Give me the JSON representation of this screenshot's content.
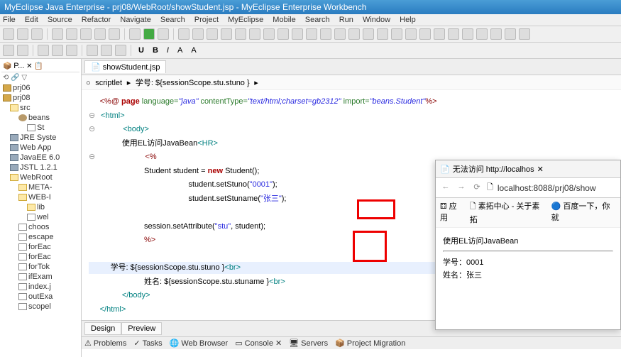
{
  "window_title": "MyEclipse Java Enterprise - prj08/WebRoot/showStudent.jsp - MyEclipse Enterprise Workbench",
  "menu": [
    "File",
    "Edit",
    "Source",
    "Refactor",
    "Navigate",
    "Search",
    "Project",
    "MyEclipse",
    "Mobile",
    "Search",
    "Run",
    "Window",
    "Help"
  ],
  "sidebar_title": "P...",
  "tree": [
    {
      "label": "prj06",
      "ic": "ic-proj",
      "ind": ""
    },
    {
      "label": "prj08",
      "ic": "ic-proj",
      "ind": ""
    },
    {
      "label": "src",
      "ic": "ic-fold",
      "ind": "ind1"
    },
    {
      "label": "beans",
      "ic": "ic-pkg",
      "ind": "ind2"
    },
    {
      "label": "St",
      "ic": "ic-file",
      "ind": "ind3"
    },
    {
      "label": "JRE Syste",
      "ic": "ic-lib",
      "ind": "ind1"
    },
    {
      "label": "Web App",
      "ic": "ic-lib",
      "ind": "ind1"
    },
    {
      "label": "JavaEE 6.0",
      "ic": "ic-lib",
      "ind": "ind1"
    },
    {
      "label": "JSTL 1.2.1",
      "ic": "ic-lib",
      "ind": "ind1"
    },
    {
      "label": "WebRoot",
      "ic": "ic-fold",
      "ind": "ind1"
    },
    {
      "label": "META-",
      "ic": "ic-fold",
      "ind": "ind2"
    },
    {
      "label": "WEB-I",
      "ic": "ic-fold",
      "ind": "ind2"
    },
    {
      "label": "lib",
      "ic": "ic-fold",
      "ind": "ind3"
    },
    {
      "label": "wel",
      "ic": "ic-file",
      "ind": "ind3"
    },
    {
      "label": "choos",
      "ic": "ic-file",
      "ind": "ind2"
    },
    {
      "label": "escape",
      "ic": "ic-file",
      "ind": "ind2"
    },
    {
      "label": "forEac",
      "ic": "ic-file",
      "ind": "ind2"
    },
    {
      "label": "forEac",
      "ic": "ic-file",
      "ind": "ind2"
    },
    {
      "label": "forTok",
      "ic": "ic-file",
      "ind": "ind2"
    },
    {
      "label": "ifExam",
      "ic": "ic-file",
      "ind": "ind2"
    },
    {
      "label": "index.j",
      "ic": "ic-file",
      "ind": "ind2"
    },
    {
      "label": "outExa",
      "ic": "ic-file",
      "ind": "ind2"
    },
    {
      "label": "scopel",
      "ic": "ic-file",
      "ind": "ind2"
    }
  ],
  "editor_tab": "showStudent.jsp",
  "breadcrumb_prefix": "scriptlet",
  "breadcrumb_text": "学号: ${sessionScope.stu.stuno }",
  "code": {
    "l1_pre": "<%@ ",
    "l1_page": "page",
    "l1_lang": " language=",
    "l1_langv": "\"java\"",
    "l1_ct": " contentType=",
    "l1_ctv": "\"text/html;charset=gb2312\"",
    "l1_imp": " import=",
    "l1_impv": "\"beans.Student\"",
    "l1_end": "%>",
    "l2": "<html>",
    "l3": "<body>",
    "l4_txt": "使用EL访问JavaBean",
    "l4_hr": "<HR>",
    "l5": "<%",
    "l6a": "Student student = ",
    "l6b": "new",
    "l6c": " Student();",
    "l7": "student.setStuno(",
    "l7v": "\"0001\"",
    "l7e": ");",
    "l8": "student.setStuname(",
    "l8v": "\"张三\"",
    "l8e": ");",
    "l10a": "session.setAttribute(",
    "l10v": "\"stu\"",
    "l10b": ", student);",
    "l11": "%>",
    "l13a": "学号: ${sessionScope",
    "l13b": ".stu.",
    "l13c": "stuno }",
    "l13br": "<br>",
    "l14a": "姓名: ${sessionScope",
    "l14b": ".stu.",
    "l14c": "stuname }",
    "l14br": "<br>",
    "l15": "</body>",
    "l16": "</html>"
  },
  "design_tabs": [
    "Design",
    "Preview"
  ],
  "bottom_tabs": [
    "Problems",
    "Tasks",
    "Web Browser",
    "Console",
    "Servers",
    "Project Migration"
  ],
  "browser": {
    "tab_title": "无法访问 http://localhos",
    "url": "localhost:8088/prj08/show",
    "bookmarks": [
      "应用",
      "素拓中心 - 关于素拓",
      "百度一下，你就"
    ],
    "body_title": "使用EL访问JavaBean",
    "line1_label": "学号：",
    "line1_val": "0001",
    "line2_label": "姓名：",
    "line2_val": "张三"
  }
}
